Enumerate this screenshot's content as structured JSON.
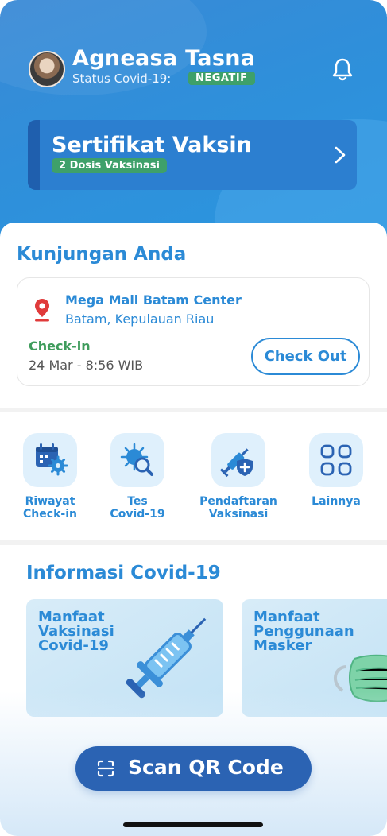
{
  "user": {
    "name": "Agneasa Tasna",
    "status_label": "Status Covid-19:",
    "status_value": "NEGATIF"
  },
  "certificate": {
    "title": "Sertifikat Vaksin",
    "subtitle": "2 Dosis Vaksinasi"
  },
  "visit": {
    "section_title": "Kunjungan Anda",
    "place_name": "Mega Mall Batam Center",
    "place_city": "Batam, Kepulauan Riau",
    "checkin_label": "Check-in",
    "checkin_time": "24 Mar - 8:56 WIB",
    "checkout_label": "Check Out"
  },
  "menu": {
    "items": [
      {
        "line1": "Riwayat",
        "line2": "Check-in",
        "icon": "calendar-gear-icon"
      },
      {
        "line1": "Tes",
        "line2": "Covid-19",
        "icon": "virus-search-icon"
      },
      {
        "line1": "Pendaftaran",
        "line2": "Vaksinasi",
        "icon": "syringe-shield-icon"
      },
      {
        "line1": "Lainnya",
        "line2": "",
        "icon": "grid-icon"
      }
    ]
  },
  "info": {
    "section_title": "Informasi Covid-19",
    "cards": [
      {
        "line1": "Manfaat",
        "line2": "Vaksinasi",
        "line3": "Covid-19"
      },
      {
        "line1": "Manfaat",
        "line2": "Penggunaan",
        "line3": "Masker"
      }
    ]
  },
  "scan": {
    "label": "Scan QR Code"
  },
  "colors": {
    "primary": "#2b8ad6",
    "header": "#2f8fda",
    "success": "#3ea06a",
    "scan_button": "#2b63b3",
    "pin": "#e03b3b"
  }
}
